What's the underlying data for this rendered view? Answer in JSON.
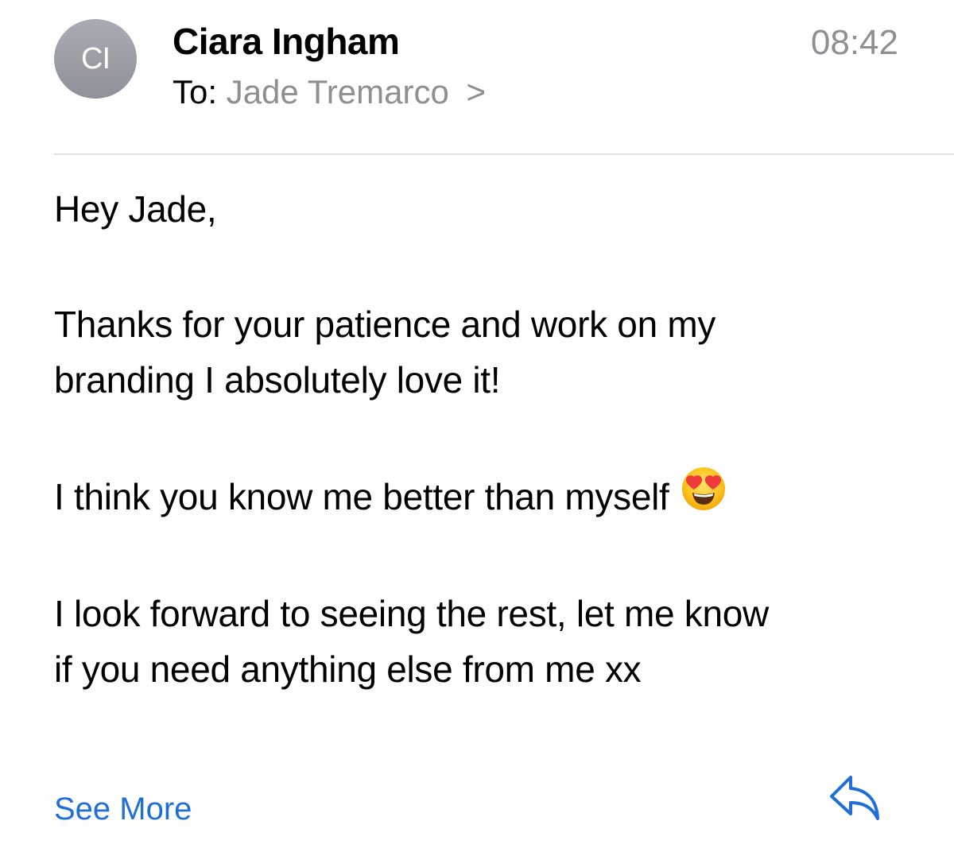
{
  "header": {
    "avatar_initials": "CI",
    "sender_name": "Ciara Ingham",
    "time": "08:42",
    "to_label": "To:",
    "recipient": "Jade Tremarco",
    "recipient_chevron": ">"
  },
  "message": {
    "greeting": "Hey Jade,",
    "paragraph_2_line_1": "Thanks for your patience and work on my",
    "paragraph_2_line_2": "branding I absolutely love it!",
    "paragraph_3": "I think you know me better than myself",
    "paragraph_3_emoji": "heart-eyes-emoji",
    "paragraph_4_line_1": "I look forward to seeing the rest, let me know",
    "paragraph_4_line_2": "if you need anything else from me xx"
  },
  "footer": {
    "see_more_label": "See More",
    "reply_icon": "reply-icon"
  },
  "colors": {
    "accent": "#1f6fd6",
    "secondary_text": "#8e8e93",
    "avatar_bg": "#9a9da4",
    "divider": "#e2e2e5"
  }
}
